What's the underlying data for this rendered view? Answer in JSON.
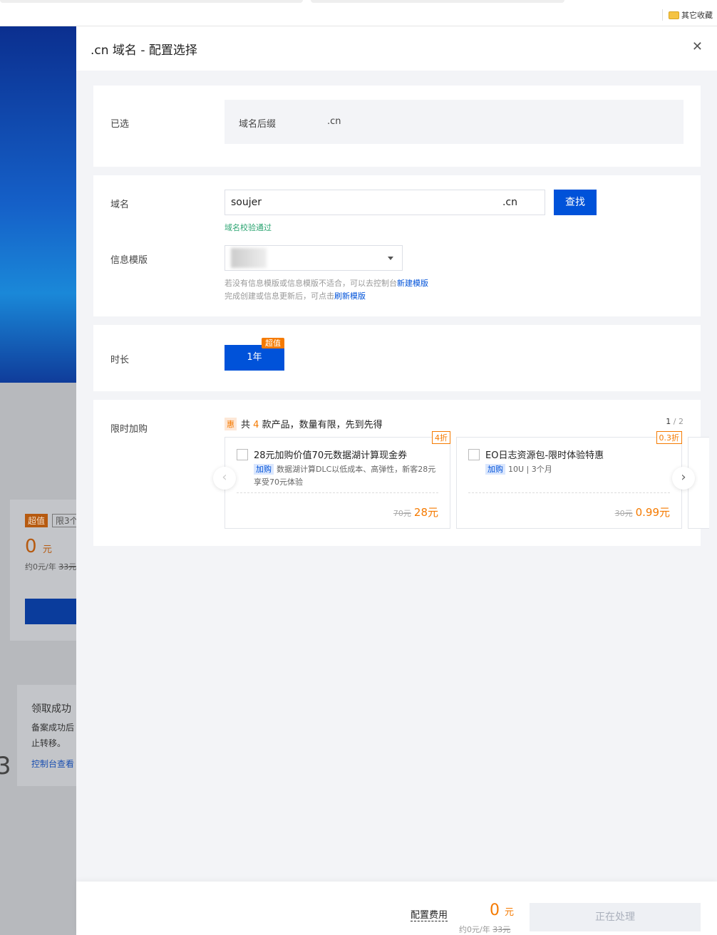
{
  "browser": {
    "bookmark": "其它收藏"
  },
  "background": {
    "tag_value": "超值",
    "tag_limit": "限3个",
    "price": "0",
    "unit": "元",
    "sub": "约0元/年",
    "sub_strike": "33元",
    "notice_title": "领取成功",
    "notice_line1": "备案成功后",
    "notice_line2": "止转移。",
    "notice_link": "控制台查看",
    "digit": "3"
  },
  "drawer": {
    "title": ".cn 域名 - 配置选择",
    "selected": {
      "label": "已选",
      "key": "域名后缀",
      "value": ".cn"
    },
    "domain": {
      "label": "域名",
      "value": "soujer",
      "suffix": ".cn",
      "search": "查找",
      "status": "域名校验通过",
      "status_color": "#2ba471"
    },
    "template": {
      "label": "信息模版",
      "hint1": "若没有信息模版或信息模版不适合，可以去控制台",
      "hint1_link": "新建模版",
      "hint2": "完成创建或信息更新后，可点击",
      "hint2_link": "刷新模版"
    },
    "duration": {
      "label": "时长",
      "option": "1年",
      "badge": "超值"
    },
    "addon": {
      "label": "限时加购",
      "icon": "惠",
      "pre": "共",
      "count": "4",
      "post": "款产品，数量有限，先到先得",
      "page": "1",
      "pages": "/ 2",
      "products": [
        {
          "discount": "4折",
          "title": "28元加购价值70元数据湖计算现金券",
          "tag": "加购",
          "desc": "数据湖计算DLC以低成本、高弹性，新客28元享受70元体验",
          "orig": "70元",
          "price": "28元"
        },
        {
          "discount": "0.3折",
          "title": "EO日志资源包-限时体验特惠",
          "tag": "加购",
          "desc": "10U | 3个月",
          "orig": "30元",
          "price": "0.99元"
        }
      ]
    },
    "footer": {
      "label": "配置费用",
      "price": "0",
      "unit": "元",
      "sub": "约0元/年",
      "sub_strike": "33元",
      "button": "正在处理"
    },
    "accent": "#0052d9",
    "price_color": "#f57a00"
  }
}
